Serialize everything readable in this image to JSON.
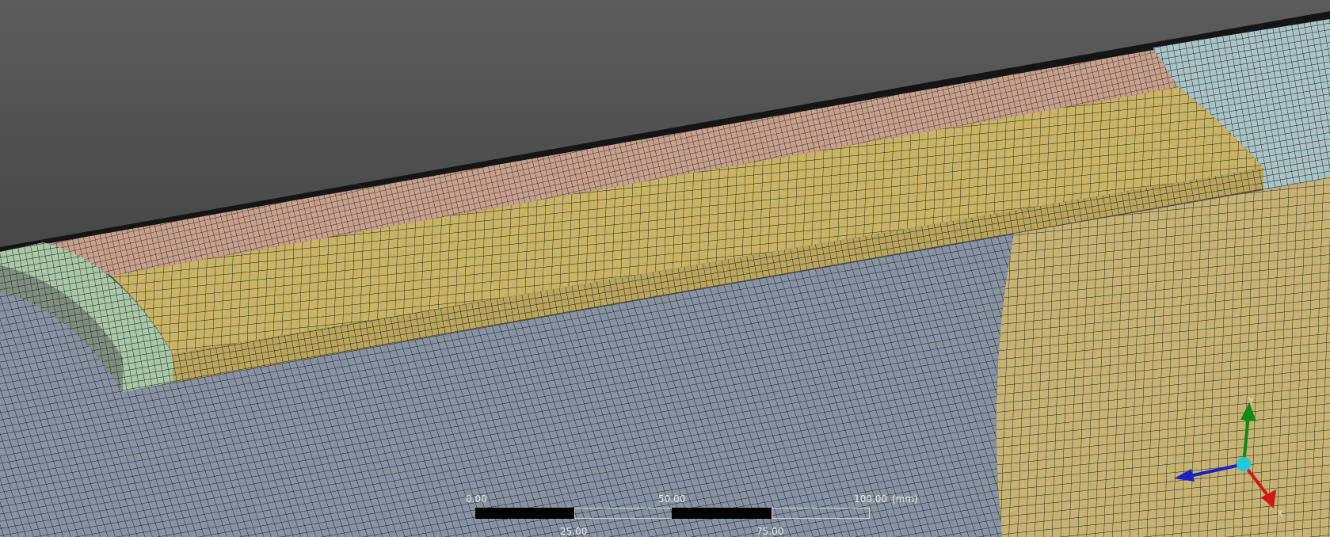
{
  "scale_bar": {
    "unit": "(mm)",
    "top_ticks": [
      "0.00",
      "50.00",
      "100.00"
    ],
    "bottom_ticks": [
      "25.00",
      "75.00"
    ]
  },
  "triad": {
    "axis_x": "X",
    "axis_y": "Y",
    "axis_z": "Z",
    "colors": {
      "x": "#d01818",
      "y": "#148a14",
      "z": "#1a22c8",
      "origin": "#22c8d8"
    }
  },
  "mesh_colors": {
    "background_top": "#5c5c5c",
    "background_bottom": "#2f2f2f",
    "inner_surface": "#8793a2",
    "rib_top": "#c9b466",
    "rib_front": "#b9a55c",
    "rim_band": "#c7a08e",
    "end_block": "#a9c8a8",
    "right_end_block": "#a9c4c6",
    "lower_right_surface": "#c6b374",
    "mesh_line": "#1b1b1b"
  }
}
